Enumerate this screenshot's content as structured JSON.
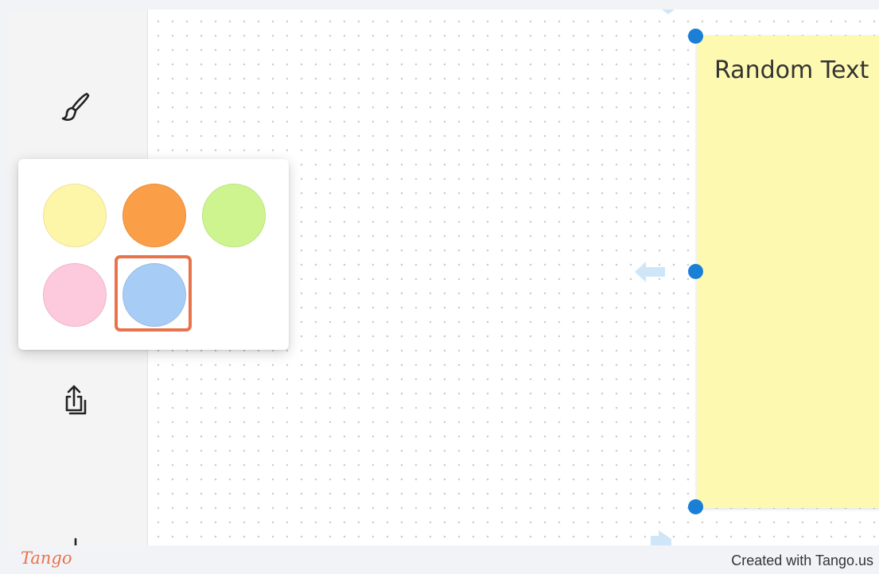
{
  "toolbar": {
    "tools": [
      {
        "name": "brush",
        "icon": "paintbrush-icon"
      },
      {
        "name": "share",
        "icon": "share-icon"
      },
      {
        "name": "add",
        "icon": "plus-icon"
      }
    ]
  },
  "canvas": {
    "sticky_note": {
      "text": "Random Text",
      "color": "#fef9b1",
      "selected": true
    },
    "handle_color": "#1a7fd6",
    "arrow_color": "#cfe6f8"
  },
  "color_picker": {
    "swatches": [
      {
        "name": "yellow",
        "color": "#fdf5a8"
      },
      {
        "name": "orange",
        "color": "#fb9e48"
      },
      {
        "name": "green",
        "color": "#cef490"
      },
      {
        "name": "pink",
        "color": "#fdc9dc"
      },
      {
        "name": "blue",
        "color": "#a7ccf5",
        "highlighted": true
      }
    ],
    "highlight_color": "#e8734a"
  },
  "footer": {
    "logo": "Tango",
    "credit": "Created with Tango.us"
  }
}
